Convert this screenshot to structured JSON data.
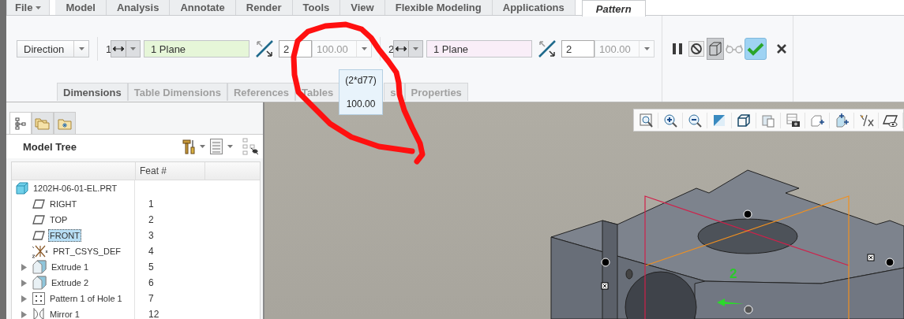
{
  "ribbon_tabs": [
    {
      "label": "File",
      "kind": "menu",
      "selected": false
    },
    {
      "label": "Model",
      "kind": "tab",
      "selected": false
    },
    {
      "label": "Analysis",
      "kind": "tab",
      "selected": false
    },
    {
      "label": "Annotate",
      "kind": "tab",
      "selected": false
    },
    {
      "label": "Render",
      "kind": "tab",
      "selected": false
    },
    {
      "label": "Tools",
      "kind": "tab",
      "selected": false
    },
    {
      "label": "View",
      "kind": "tab",
      "selected": false
    },
    {
      "label": "Flexible Modeling",
      "kind": "tab",
      "selected": false
    },
    {
      "label": "Applications",
      "kind": "tab",
      "selected": false
    },
    {
      "label": "Pattern",
      "kind": "tab",
      "selected": true
    }
  ],
  "pattern_type": {
    "value": "Direction"
  },
  "directions": [
    {
      "number": "1",
      "collector": "1 Plane",
      "color": "#e6f6d8",
      "count": "2",
      "spacing": "100.00"
    },
    {
      "number": "2",
      "collector": "1 Plane",
      "color": "#f9eef8",
      "count": "2",
      "spacing": "100.00"
    }
  ],
  "actions": [
    {
      "kind": "pause",
      "on": false,
      "disabled": false
    },
    {
      "kind": "stop",
      "on": false,
      "disabled": false
    },
    {
      "kind": "preview",
      "on": true,
      "disabled": false
    },
    {
      "kind": "glasses",
      "on": false,
      "disabled": true
    },
    {
      "kind": "apply",
      "on": false,
      "disabled": false
    },
    {
      "kind": "cancel",
      "on": false,
      "disabled": false
    }
  ],
  "subtabs": [
    {
      "label": "Dimensions",
      "selected": true
    },
    {
      "label": "Table Dimensions",
      "selected": false
    },
    {
      "label": "References",
      "selected": false
    },
    {
      "label": "Tables",
      "selected": false
    },
    {
      "label": "s",
      "selected": false
    },
    {
      "label": "Properties",
      "selected": false
    }
  ],
  "tooltip": {
    "lines": [
      "(2*d77)",
      "100.00"
    ]
  },
  "model_tree": {
    "panel_tabs": [
      {
        "kind": "tree",
        "selected": true
      },
      {
        "kind": "folders",
        "selected": false
      },
      {
        "kind": "favorites",
        "selected": false
      }
    ],
    "title": "Model Tree",
    "columns": [
      "Feat #"
    ],
    "items": [
      {
        "name": "1202H-06-01-EL.PRT",
        "kind": "part",
        "selected": false,
        "children": [
          {
            "name": "RIGHT",
            "kind": "plane",
            "feat": "1",
            "selected": false
          },
          {
            "name": "TOP",
            "kind": "plane",
            "feat": "2",
            "selected": false
          },
          {
            "name": "FRONT",
            "kind": "plane",
            "feat": "3",
            "selected": true
          },
          {
            "name": "PRT_CSYS_DEF",
            "kind": "csys",
            "feat": "4",
            "selected": false
          },
          {
            "name": "Extrude 1",
            "kind": "extrude",
            "feat": "5",
            "selected": false,
            "expanded": false
          },
          {
            "name": "Extrude 2",
            "kind": "extrude",
            "feat": "6",
            "selected": false,
            "expanded": false
          },
          {
            "name": "Pattern 1 of Hole 1",
            "kind": "pattern",
            "feat": "7",
            "selected": false,
            "expanded": false
          },
          {
            "name": "Mirror 1",
            "kind": "mirror",
            "feat": "12",
            "selected": false,
            "expanded": false
          }
        ]
      }
    ]
  },
  "viewport": {
    "dimension_label": "2"
  }
}
